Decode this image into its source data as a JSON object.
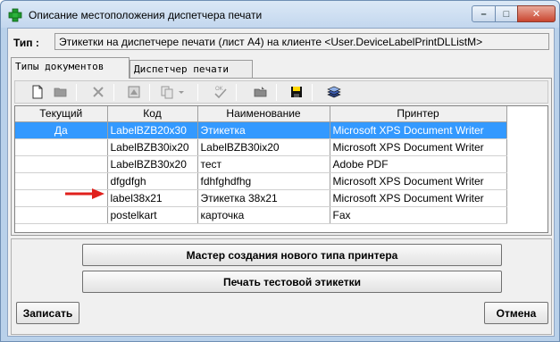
{
  "window": {
    "title": "Описание местоположения диспетчера печати",
    "controls": {
      "minimize": "–",
      "maximize": "□",
      "close": "✕"
    }
  },
  "type": {
    "label": "Тип :",
    "value": "Этикетки на диспетчере печати (лист А4) на клиенте <User.DeviceLabelPrintDLListM>"
  },
  "tabs": [
    {
      "label": "Типы документов",
      "active": true
    },
    {
      "label": "Диспетчер печати",
      "active": false
    }
  ],
  "toolbar": {
    "icons": [
      "new-document-icon",
      "open-folder-icon",
      "delete-icon",
      "properties-icon",
      "copy-dropdown-icon",
      "check-icon",
      "folder-icon",
      "save-disk-icon",
      "stack-icon"
    ]
  },
  "grid": {
    "columns": [
      "Текущий",
      "Код",
      "Наименование",
      "Принтер"
    ],
    "rows": [
      {
        "current": "Да",
        "code": "LabelBZB20x30",
        "name": "Этикетка",
        "printer": "Microsoft XPS Document Writer",
        "selected": true
      },
      {
        "current": "",
        "code": "LabelBZB30ix20",
        "name": "LabelBZB30ix20",
        "printer": "Microsoft XPS Document Writer",
        "selected": false
      },
      {
        "current": "",
        "code": "LabelBZB30x20",
        "name": "тест",
        "printer": "Adobe PDF",
        "selected": false
      },
      {
        "current": "",
        "code": "dfgdfgh",
        "name": "fdhfghdfhg",
        "printer": "Microsoft XPS Document Writer",
        "selected": false
      },
      {
        "current": "",
        "code": "label38x21",
        "name": "Этикетка 38х21",
        "printer": "Microsoft XPS Document Writer",
        "selected": false
      },
      {
        "current": "",
        "code": "postelkart",
        "name": "карточка",
        "printer": "Fax",
        "selected": false
      }
    ]
  },
  "buttons": {
    "wizard": "Мастер создания нового типа принтера",
    "test_print": "Печать тестовой этикетки",
    "save": "Записать",
    "cancel": "Отмена"
  },
  "colors": {
    "selection": "#3399ff",
    "arrow": "#e0201c",
    "titlebar": "#c3d7ee"
  }
}
